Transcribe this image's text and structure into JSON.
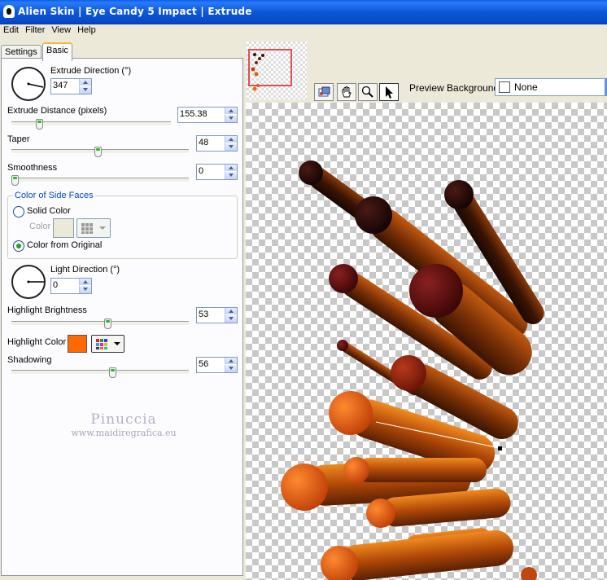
{
  "window": {
    "title": "Alien Skin | Eye Candy 5 Impact | Extrude"
  },
  "menu": [
    "Edit",
    "Filter",
    "View",
    "Help"
  ],
  "tabs": [
    {
      "label": "Settings"
    },
    {
      "label": "Basic"
    }
  ],
  "controls": {
    "extrude_direction": {
      "label": "Extrude Direction (°)",
      "value": "347"
    },
    "extrude_distance": {
      "label": "Extrude Distance (pixels)",
      "value": "155.38",
      "slider_fraction": 0.18
    },
    "taper": {
      "label": "Taper",
      "value": "48",
      "slider_fraction": 0.48
    },
    "smoothness": {
      "label": "Smoothness",
      "value": "0",
      "slider_fraction": 0.0
    },
    "side_faces": {
      "title": "Color of Side Faces",
      "option_solid": "Solid Color",
      "color_label": "Color",
      "option_original": "Color from Original",
      "selected": "Color from Original",
      "solid_color": "#ece9d8"
    },
    "light_direction": {
      "label": "Light Direction (°)",
      "value": "0"
    },
    "highlight_brightness": {
      "label": "Highlight Brightness",
      "value": "53",
      "slider_fraction": 0.53
    },
    "highlight_color": {
      "label": "Highlight Color",
      "color": "#ff6a00"
    },
    "shadowing": {
      "label": "Shadowing",
      "value": "56",
      "slider_fraction": 0.56
    }
  },
  "watermark": {
    "name": "Pinuccia",
    "site": "www.maidiregrafica.eu"
  },
  "preview": {
    "background_label": "Preview Background:",
    "background_value": "None",
    "tools": [
      "navigator-icon",
      "hand-icon",
      "zoom-icon",
      "arrow-icon"
    ]
  }
}
